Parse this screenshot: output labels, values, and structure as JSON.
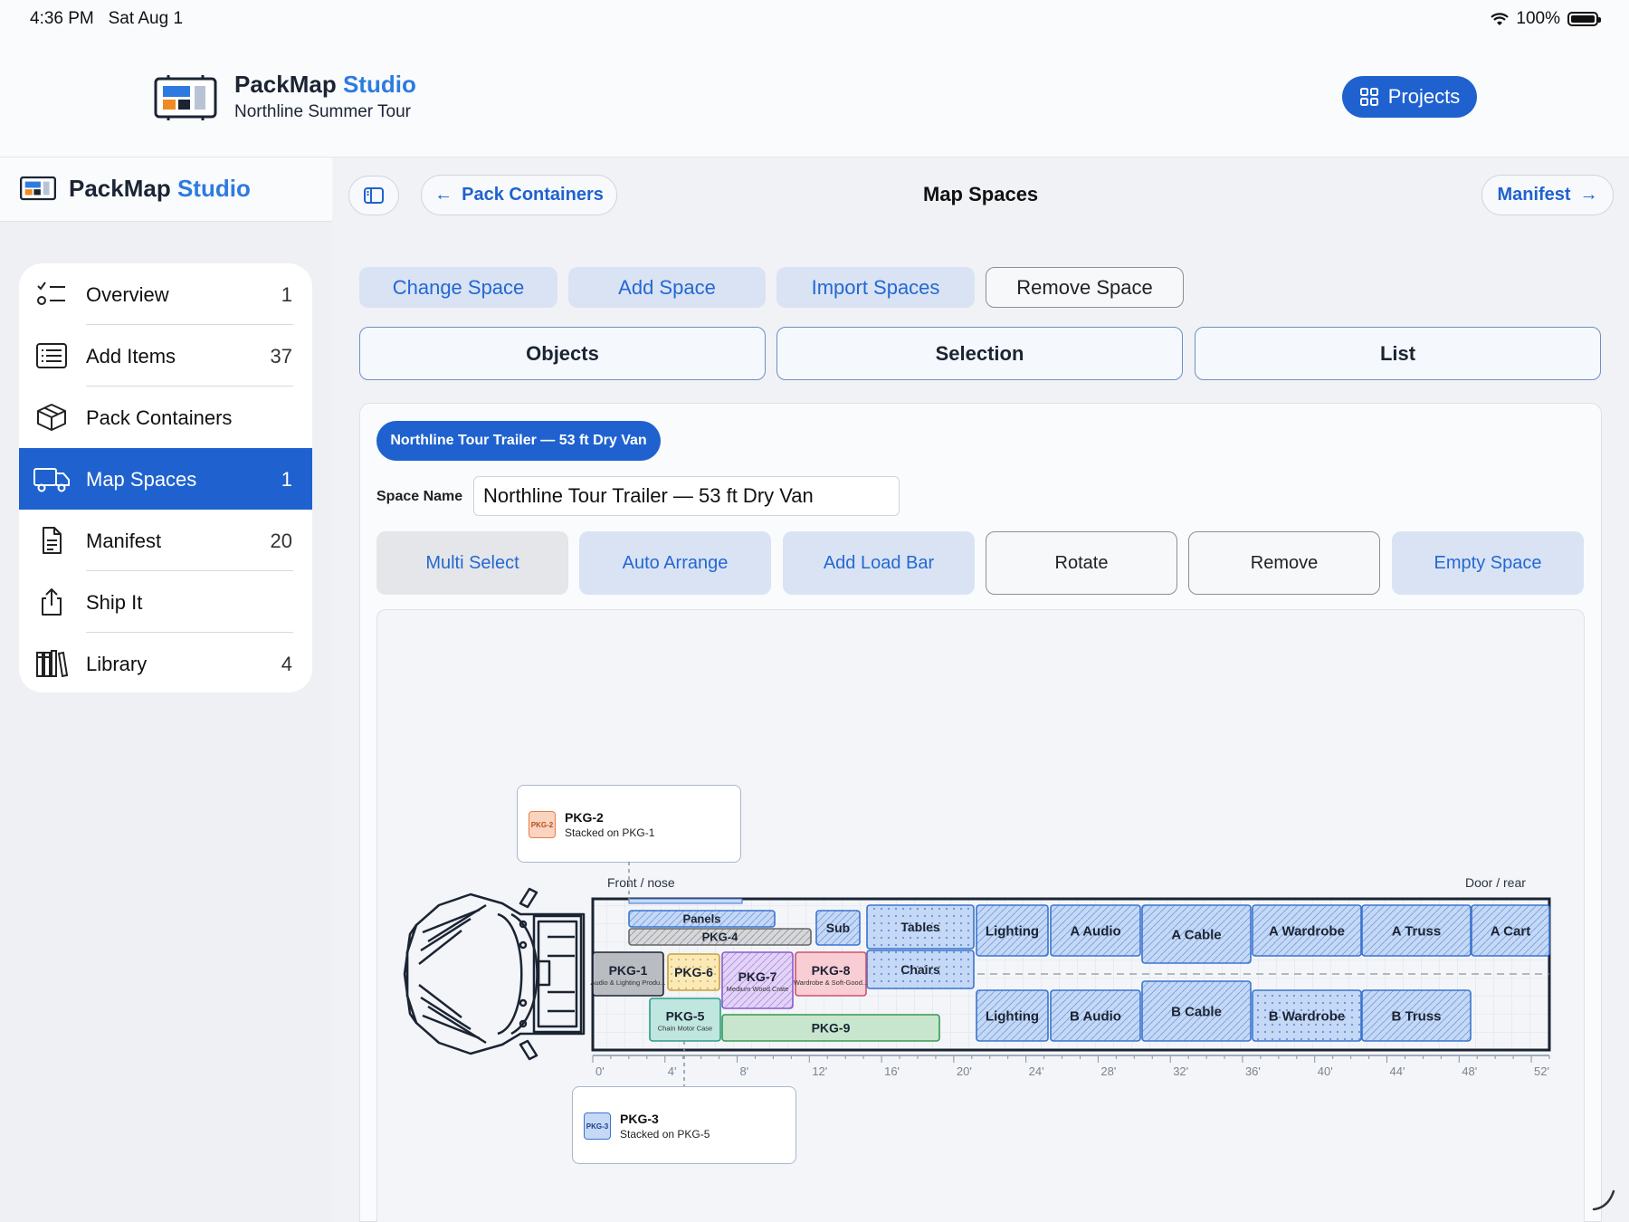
{
  "status": {
    "time": "4:36 PM",
    "date": "Sat Aug 1",
    "battery": "100%"
  },
  "header": {
    "brand_main": "PackMap",
    "brand_accent": "Studio",
    "subtitle": "Northline Summer Tour",
    "projects_label": "Projects"
  },
  "sidebar": {
    "brand_main": "PackMap",
    "brand_accent": "Studio",
    "items": [
      {
        "label": "Overview",
        "count": "1",
        "icon": "checklist-icon"
      },
      {
        "label": "Add Items",
        "count": "37",
        "icon": "list-icon"
      },
      {
        "label": "Pack Containers",
        "count": "",
        "icon": "box-icon"
      },
      {
        "label": "Map Spaces",
        "count": "1",
        "icon": "truck-icon",
        "active": true
      },
      {
        "label": "Manifest",
        "count": "20",
        "icon": "document-icon"
      },
      {
        "label": "Ship It",
        "count": "",
        "icon": "share-icon"
      },
      {
        "label": "Library",
        "count": "4",
        "icon": "books-icon"
      }
    ]
  },
  "nav": {
    "back_label": "Pack Containers",
    "title": "Map Spaces",
    "forward_label": "Manifest"
  },
  "space_actions": [
    "Change Space",
    "Add Space",
    "Import Spaces",
    "Remove Space"
  ],
  "segments": [
    "Objects",
    "Selection",
    "List"
  ],
  "space": {
    "chip": "Northline Tour Trailer — 53 ft Dry Van",
    "name_label": "Space Name",
    "name_value": "Northline Tour Trailer — 53 ft Dry Van"
  },
  "tools": [
    "Multi Select",
    "Auto Arrange",
    "Add Load Bar",
    "Rotate",
    "Remove",
    "Empty Space"
  ],
  "map": {
    "front_label": "Front / nose",
    "rear_label": "Door / rear",
    "ruler": [
      "0'",
      "4'",
      "8'",
      "12'",
      "16'",
      "20'",
      "24'",
      "28'",
      "32'",
      "36'",
      "40'",
      "44'",
      "48'",
      "52'"
    ],
    "items": [
      {
        "label": "Panels",
        "sub": ""
      },
      {
        "label": "PKG-4",
        "sub": ""
      },
      {
        "label": "Sub",
        "sub": ""
      },
      {
        "label": "Tables",
        "sub": ""
      },
      {
        "label": "Chairs",
        "sub": ""
      },
      {
        "label": "PKG-1",
        "sub": "Audio & Lighting Produ..."
      },
      {
        "label": "PKG-6",
        "sub": ""
      },
      {
        "label": "PKG-7",
        "sub": "Medium Wood Crate"
      },
      {
        "label": "PKG-8",
        "sub": "Wardrobe & Soft-Good..."
      },
      {
        "label": "PKG-5",
        "sub": "Chain Motor Case"
      },
      {
        "label": "PKG-9",
        "sub": ""
      },
      {
        "label": "Lighting",
        "sub": ""
      },
      {
        "label": "A Audio",
        "sub": ""
      },
      {
        "label": "A Cable",
        "sub": ""
      },
      {
        "label": "A Wardrobe",
        "sub": ""
      },
      {
        "label": "A Truss",
        "sub": ""
      },
      {
        "label": "A Cart",
        "sub": ""
      },
      {
        "label": "Lighting",
        "sub": ""
      },
      {
        "label": "B Audio",
        "sub": ""
      },
      {
        "label": "B Cable",
        "sub": ""
      },
      {
        "label": "B Wardrobe",
        "sub": ""
      },
      {
        "label": "B Truss",
        "sub": ""
      }
    ],
    "callouts": [
      {
        "swatch": "PKG-2",
        "title": "PKG-2",
        "sub": "Stacked on PKG-1"
      },
      {
        "swatch": "PKG-3",
        "title": "PKG-3",
        "sub": "Stacked on PKG-5"
      }
    ]
  },
  "colors": {
    "accent": "#1f62cf",
    "brand_accent": "#2d7be0",
    "tinted_button": "#d9e3f3"
  }
}
